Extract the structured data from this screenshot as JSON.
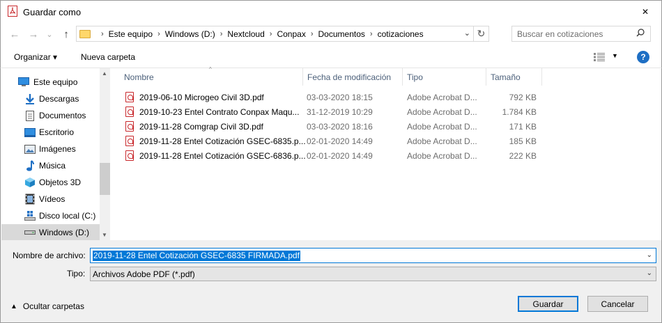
{
  "window": {
    "title": "Guardar como",
    "close_glyph": "✕"
  },
  "nav": {
    "back_glyph": "←",
    "forward_glyph": "→",
    "recent_glyph": "⌄",
    "up_glyph": "↑",
    "breadcrumbs": [
      "Este equipo",
      "Windows (D:)",
      "Nextcloud",
      "Conpax",
      "Documentos",
      "cotizaciones"
    ],
    "separator": "›",
    "search_placeholder": "Buscar en cotizaciones"
  },
  "toolbar": {
    "organizar_label": "Organizar ▾",
    "nueva_carpeta_label": "Nueva carpeta",
    "help_label": "?"
  },
  "sidebar": {
    "items": [
      {
        "label": "Este equipo",
        "icon": "computer-icon"
      },
      {
        "label": "Descargas",
        "icon": "download-icon"
      },
      {
        "label": "Documentos",
        "icon": "document-icon"
      },
      {
        "label": "Escritorio",
        "icon": "desktop-icon"
      },
      {
        "label": "Imágenes",
        "icon": "pictures-icon"
      },
      {
        "label": "Música",
        "icon": "music-icon"
      },
      {
        "label": "Objetos 3D",
        "icon": "cube-icon"
      },
      {
        "label": "Vídeos",
        "icon": "video-icon"
      },
      {
        "label": "Disco local (C:)",
        "icon": "drive-icon"
      },
      {
        "label": "Windows (D:)",
        "icon": "drive-icon",
        "selected": true
      }
    ]
  },
  "filelist": {
    "columns": [
      "Nombre",
      "Fecha de modificación",
      "Tipo",
      "Tamaño"
    ],
    "rows": [
      {
        "name": "2019-06-10 Microgeo Civil 3D.pdf",
        "date": "03-03-2020 18:15",
        "type": "Adobe Acrobat D...",
        "size": "792 KB"
      },
      {
        "name": "2019-10-23 Entel Contrato Conpax Maqu...",
        "date": "31-12-2019 10:29",
        "type": "Adobe Acrobat D...",
        "size": "1.784 KB"
      },
      {
        "name": "2019-11-28 Comgrap Civil 3D.pdf",
        "date": "03-03-2020 18:16",
        "type": "Adobe Acrobat D...",
        "size": "171 KB"
      },
      {
        "name": "2019-11-28 Entel Cotización GSEC-6835.p...",
        "date": "02-01-2020 14:49",
        "type": "Adobe Acrobat D...",
        "size": "185 KB"
      },
      {
        "name": "2019-11-28 Entel Cotización GSEC-6836.p...",
        "date": "02-01-2020 14:49",
        "type": "Adobe Acrobat D...",
        "size": "222 KB"
      }
    ]
  },
  "form": {
    "filename_label": "Nombre de archivo:",
    "filename_value": "2019-11-28 Entel Cotización GSEC-6835 FIRMADA.pdf",
    "type_label": "Tipo:",
    "type_value": "Archivos Adobe PDF (*.pdf)",
    "hide_folders_label": "Ocultar carpetas",
    "save_label": "Guardar",
    "cancel_label": "Cancelar"
  },
  "colors": {
    "accent": "#0078d7",
    "pdf_red": "#c8272b",
    "header_text": "#4c607a"
  }
}
